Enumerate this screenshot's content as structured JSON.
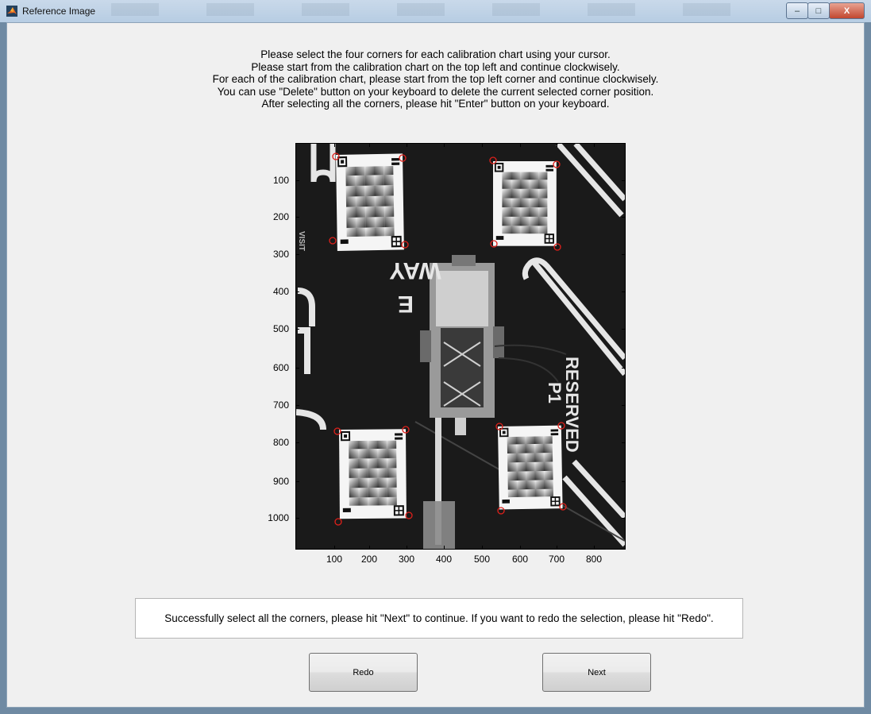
{
  "window": {
    "title": "Reference Image",
    "controls": {
      "minimize": "–",
      "maximize": "□",
      "close": "X"
    }
  },
  "instructions": [
    "Please select the four corners for each calibration chart using your cursor.",
    "Please start from the calibration chart on the top left and continue clockwisely.",
    "For each of the calibration chart, please start from the top left corner and continue clockwisely.",
    "You can use \"Delete\" button on your keyboard to delete the current selected corner position.",
    "After selecting all the corners, please hit \"Enter\" button on your keyboard."
  ],
  "axes": {
    "x_ticks": [
      "100",
      "200",
      "300",
      "400",
      "500",
      "600",
      "700",
      "800"
    ],
    "y_ticks": [
      "100",
      "200",
      "300",
      "400",
      "500",
      "600",
      "700",
      "800",
      "900",
      "1000"
    ],
    "image_text": {
      "reserved": "RESERVED",
      "p1": "P1",
      "way": "WAY",
      "e": "E",
      "side": "VISIT"
    }
  },
  "status_message": "Successfully select all the corners, please hit \"Next\" to continue. If you want to redo the selection, please hit \"Redo\".",
  "buttons": {
    "redo": "Redo",
    "next": "Next"
  },
  "colors": {
    "marker": "#e0201a",
    "background": "#f0f0f0"
  }
}
